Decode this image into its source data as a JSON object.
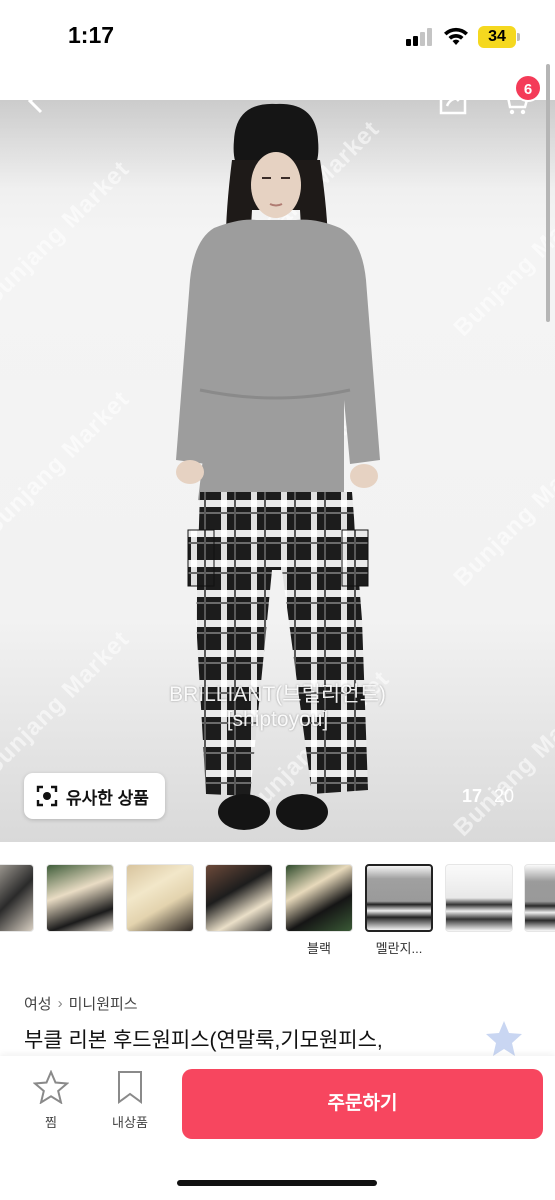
{
  "status_bar": {
    "time": "1:17",
    "battery": "34"
  },
  "header": {
    "cart_count": "6"
  },
  "hero": {
    "watermark": "Bunjang Market",
    "brand_line1": "BRILLIANT(브릴리언트)",
    "brand_line2": "[shiptoyou]",
    "similar_label": "유사한 상품",
    "image_current": "17",
    "image_total": "20"
  },
  "thumbnails": [
    {
      "caption": ""
    },
    {
      "caption": ""
    },
    {
      "caption": ""
    },
    {
      "caption": ""
    },
    {
      "caption": "블랙"
    },
    {
      "caption": "멜란지..."
    },
    {
      "caption": ""
    },
    {
      "caption": ""
    }
  ],
  "product": {
    "category_1": "여성",
    "category_2": "미니원피스",
    "title": "부클 리본 후드원피스(연말룩,기모원피스,"
  },
  "bottom_bar": {
    "like_label": "찜",
    "mystore_label": "내상품",
    "order_label": "주문하기"
  },
  "colors": {
    "accent": "#f7465f",
    "badge": "#f43b58"
  }
}
